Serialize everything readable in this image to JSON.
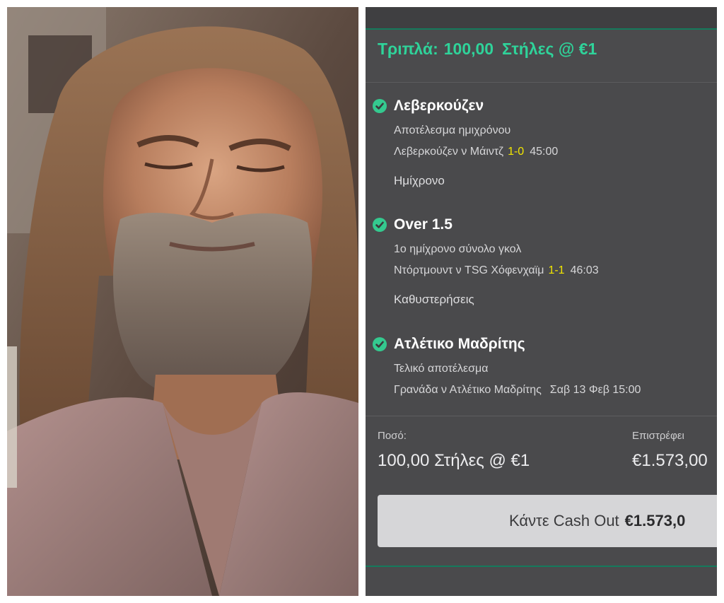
{
  "photo": {
    "description_icon": "bearded-man-photo"
  },
  "slip": {
    "title_type": "Τριπλά:",
    "title_amount": "100,00",
    "title_stakes": "Στήλες @ €1",
    "selections": [
      {
        "name": "Λεβερκούζεν",
        "market": "Αποτέλεσμα ημιχρόνου",
        "match": "Λεβερκούζεν ν Μάιντζ",
        "score": "1-0",
        "time": "45:00",
        "extra": "Ημίχρονο"
      },
      {
        "name": "Over 1.5",
        "market": "1ο ημίχρονο σύνολο γκολ",
        "match": "Ντόρτμουντ ν TSG Χόφενχαϊμ",
        "score": "1-1",
        "time": "46:03",
        "extra": "Καθυστερήσεις"
      },
      {
        "name": "Ατλέτικο Μαδρίτης",
        "market": "Τελικό αποτέλεσμα",
        "match": "Γρανάδα ν Ατλέτικο Μαδρίτης",
        "date": "Σαβ 13 Φεβ 15:00"
      }
    ],
    "stake_label": "Ποσό:",
    "stake_value": "100,00 Στήλες @ €1",
    "returns_label": "Επιστρέφει",
    "returns_value": "€1.573,00",
    "cashout_label": "Κάντε Cash Out",
    "cashout_amount": "€1.573,0",
    "check_icon": "check-circle-icon",
    "colors": {
      "accent_green": "#2fd39a",
      "score_yellow": "#f2e600",
      "background": "#4a4a4c"
    }
  }
}
